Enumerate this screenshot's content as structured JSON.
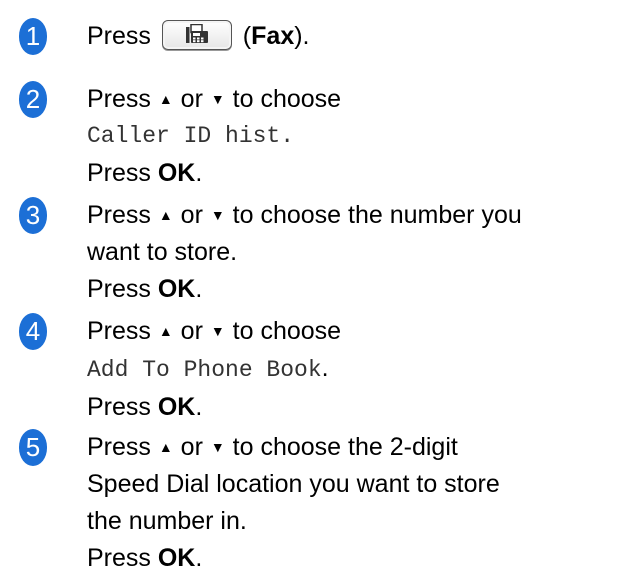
{
  "colors": {
    "badge": "#1c6fd6"
  },
  "steps": [
    {
      "number": "1",
      "press": "Press",
      "key_icon": "fax-key-icon",
      "paren_open": " (",
      "key_label": "Fax",
      "paren_close": ")."
    },
    {
      "number": "2",
      "press": "Press",
      "up": "▲",
      "or": "or",
      "down": "▼",
      "choose": "to choose",
      "option": "Caller ID hist.",
      "press2": "Press",
      "ok": "OK",
      "period": "."
    },
    {
      "number": "3",
      "press": "Press",
      "up": "▲",
      "or": "or",
      "down": "▼",
      "choose": "to choose the number you",
      "text2": "want to store.",
      "press2": "Press",
      "ok": "OK",
      "period": "."
    },
    {
      "number": "4",
      "press": "Press",
      "up": "▲",
      "or": "or",
      "down": "▼",
      "choose": "to choose",
      "option": "Add To Phone Book",
      "option_period": ".",
      "press2": "Press",
      "ok": "OK",
      "period": "."
    },
    {
      "number": "5",
      "press": "Press",
      "up": "▲",
      "or": "or",
      "down": "▼",
      "choose": "to choose the 2-digit",
      "text2": "Speed Dial location you want to store",
      "text3": "the number in.",
      "press2": "Press",
      "ok": "OK",
      "period": "."
    }
  ]
}
